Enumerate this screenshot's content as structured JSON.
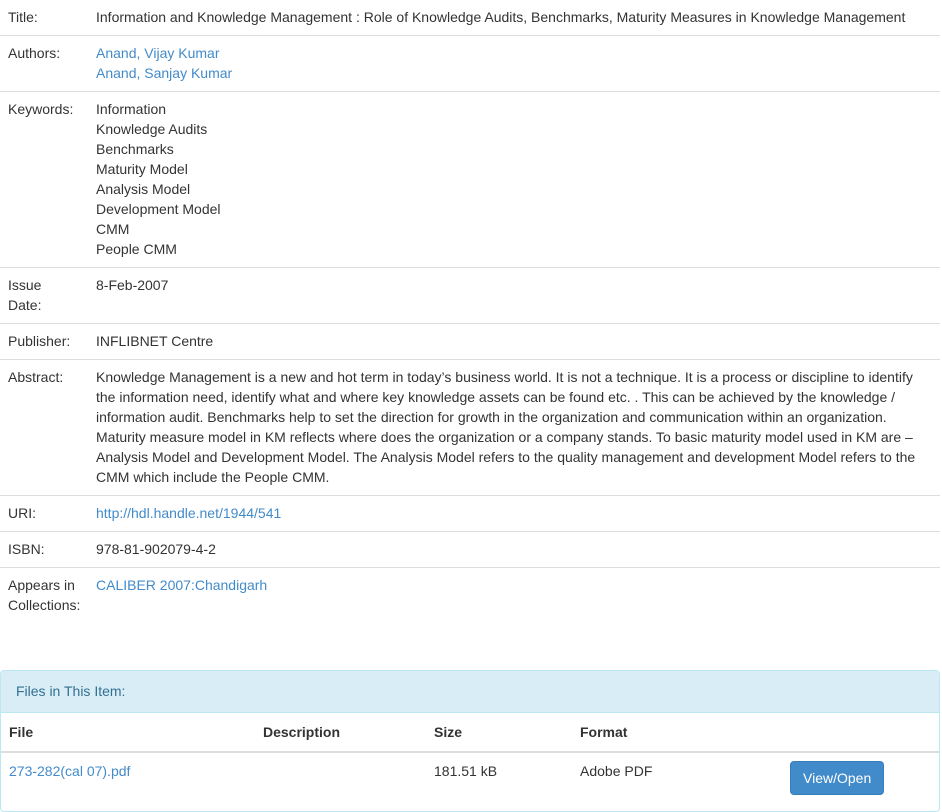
{
  "metadata": {
    "title": {
      "label": "Title:",
      "value": "Information and Knowledge Management : Role of Knowledge Audits, Benchmarks, Maturity Measures in Knowledge Management"
    },
    "authors": {
      "label": "Authors:",
      "items": [
        "Anand, Vijay Kumar",
        "Anand, Sanjay Kumar"
      ]
    },
    "keywords": {
      "label": "Keywords:",
      "items": [
        "Information",
        "Knowledge Audits",
        "Benchmarks",
        "Maturity Model",
        "Analysis Model",
        "Development Model",
        "CMM",
        "People CMM"
      ]
    },
    "issue_date": {
      "label_line1": "Issue",
      "label_line2": "Date:",
      "value": "8-Feb-2007"
    },
    "publisher": {
      "label": "Publisher:",
      "value": "INFLIBNET Centre"
    },
    "abstract": {
      "label": "Abstract:",
      "value": "Knowledge Management is a new and hot term in today’s business world. It is not a technique. It is a process or discipline to identify the information need, identify what and where key knowledge assets can be found etc. . This can be achieved by the knowledge / information audit. Benchmarks help to set the direction for growth in the organization and communication within an organization. Maturity measure model in KM reflects where does the organization or a company stands. To basic maturity model used in KM are – Analysis Model and Development Model. The Analysis Model refers to the quality management and development Model refers to the CMM which include the People CMM."
    },
    "uri": {
      "label": "URI:",
      "value": "http://hdl.handle.net/1944/541"
    },
    "isbn": {
      "label": "ISBN:",
      "value": "978-81-902079-4-2"
    },
    "collections": {
      "label_line1": "Appears in",
      "label_line2": "Collections:",
      "value": "CALIBER 2007:Chandigarh"
    }
  },
  "files": {
    "heading": "Files in This Item:",
    "columns": {
      "file": "File",
      "description": "Description",
      "size": "Size",
      "format": "Format"
    },
    "rows": [
      {
        "file": "273-282(cal 07).pdf",
        "description": "",
        "size": "181.51 kB",
        "format": "Adobe PDF",
        "action": "View/Open"
      }
    ]
  },
  "colors": {
    "link": "#428bca",
    "panel_heading_bg": "#d9edf7",
    "panel_heading_text": "#31708f",
    "button_bg": "#428bca"
  }
}
